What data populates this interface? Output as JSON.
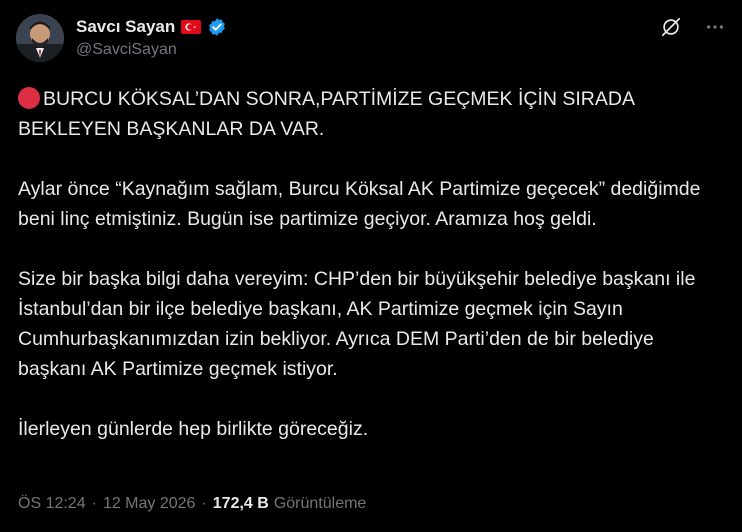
{
  "author": {
    "display_name": "Savcı Sayan",
    "handle": "@SavciSayan",
    "flag_icon": "turkey-flag-icon",
    "verified_icon": "verified-badge-icon",
    "verified_color": "#1d9bf0"
  },
  "top_actions": {
    "grok_icon": "grok-icon",
    "more_icon": "more-options-icon"
  },
  "tweet": {
    "paragraphs": [
      "BURCU KÖKSAL’DAN SONRA,PARTİMİZE GEÇMEK İÇİN SIRADA BEKLEYEN BAŞKANLAR DA VAR.",
      "Aylar önce “Kaynağım sağlam, Burcu Köksal AK Partimize geçecek” dediğimde beni linç etmiştiniz. Bugün ise partimize geçiyor. Aramıza hoş geldi.",
      "Size bir başka bilgi daha vereyim: CHP’den bir büyükşehir belediye başkanı ile İstanbul’dan bir ilçe belediye başkanı, AK Partimize geçmek için Sayın Cumhurbaşkanımızdan izin bekliyor. Ayrıca DEM Parti’den de bir belediye başkanı AK Partimize geçmek istiyor.",
      "İlerleyen günlerde hep birlikte göreceğiz."
    ],
    "lead_icon": "red-circle-icon"
  },
  "meta": {
    "time": "ÖS 12:24",
    "separator": "·",
    "date": "12 May 2026",
    "views_count": "172,4 B",
    "views_label": "Görüntüleme"
  },
  "colors": {
    "background": "#000000",
    "text": "#e7e9ea",
    "secondary": "#71767b",
    "red_dot": "#dd2e44"
  }
}
